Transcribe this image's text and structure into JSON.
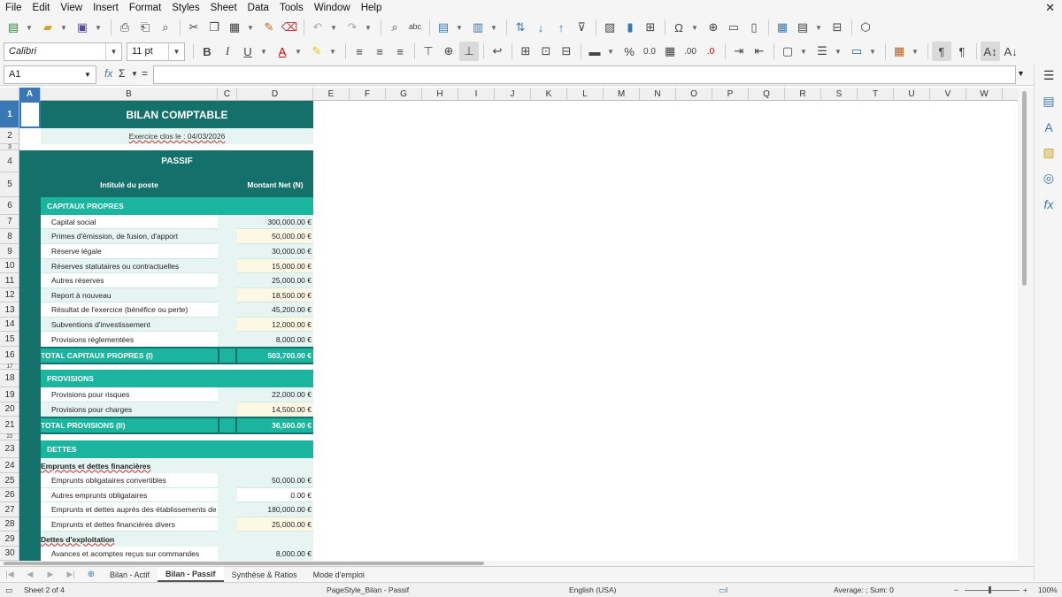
{
  "menu": [
    "File",
    "Edit",
    "View",
    "Insert",
    "Format",
    "Styles",
    "Sheet",
    "Data",
    "Tools",
    "Window",
    "Help"
  ],
  "toolbar": {
    "font_name": "Calibri",
    "font_size": "11 pt"
  },
  "formula_bar": {
    "cell_ref": "A1",
    "value": ""
  },
  "columns": [
    "A",
    "B",
    "C",
    "D",
    "E",
    "F",
    "G",
    "H",
    "I",
    "J",
    "K",
    "L",
    "M",
    "N",
    "O",
    "P",
    "Q",
    "R",
    "S",
    "T",
    "U",
    "V",
    "W"
  ],
  "rows": [
    "1",
    "2",
    "3",
    "4",
    "5",
    "6",
    "7",
    "8",
    "9",
    "10",
    "11",
    "12",
    "13",
    "14",
    "15",
    "16",
    "17",
    "18",
    "19",
    "20",
    "21",
    "22",
    "23",
    "24",
    "25",
    "26",
    "27",
    "28",
    "29",
    "30"
  ],
  "sheet": {
    "title": "BILAN COMPTABLE",
    "subtitle": "Exercice clos le : 04/03/2026",
    "section_header": "PASSIF",
    "col_label": "Intitulé du poste",
    "col_amount": "Montant Net (N)",
    "cap_header": "CAPITAUX PROPRES",
    "cap_items": [
      {
        "label": "Capital social",
        "amount": "300,000.00 €"
      },
      {
        "label": "Primes d'émission, de fusion, d'apport",
        "amount": "50,000.00 €"
      },
      {
        "label": "Réserve légale",
        "amount": "30,000.00 €"
      },
      {
        "label": "Réserves statutaires ou contractuelles",
        "amount": "15,000.00 €"
      },
      {
        "label": "Autres réserves",
        "amount": "25,000.00 €"
      },
      {
        "label": "Report à nouveau",
        "amount": "18,500.00 €"
      },
      {
        "label": "Résultat de l'exercice (bénéfice ou perte)",
        "amount": "45,200.00 €"
      },
      {
        "label": "Subventions d'investissement",
        "amount": "12,000.00 €"
      },
      {
        "label": "Provisions réglementées",
        "amount": "8,000.00 €"
      }
    ],
    "cap_total_label": "TOTAL CAPITAUX PROPRES (I)",
    "cap_total": "503,700.00 €",
    "prov_header": "PROVISIONS",
    "prov_items": [
      {
        "label": "Provisions pour risques",
        "amount": "22,000.00 €"
      },
      {
        "label": "Provisions pour charges",
        "amount": "14,500.00 €"
      }
    ],
    "prov_total_label": "TOTAL PROVISIONS (II)",
    "prov_total": "36,500.00 €",
    "debt_header": "DETTES",
    "debt_sub1": "Emprunts et dettes financières",
    "debt_items": [
      {
        "label": "Emprunts obligataires convertibles",
        "amount": "50,000.00 €"
      },
      {
        "label": "Autres emprunts obligataires",
        "amount": "0.00 €"
      },
      {
        "label": "Emprunts et dettes auprès des établissements de crédit",
        "amount": "180,000.00 €"
      },
      {
        "label": "Emprunts et dettes financières divers",
        "amount": "25,000.00 €"
      }
    ],
    "debt_sub2": "Dettes d'exploitation",
    "debt_items2": [
      {
        "label": "Avances et acomptes reçus sur commandes",
        "amount": "8,000.00 €"
      }
    ]
  },
  "tabs": [
    "Bilan - Actif",
    "Bilan - Passif",
    "Synthèse & Ratios",
    "Mode d'emploi"
  ],
  "status": {
    "sheet": "Sheet 2 of 4",
    "pagestyle": "PageStyle_Bilan - Passif",
    "language": "English (USA)",
    "sum": "Average: ; Sum: 0",
    "zoom": "100%"
  },
  "colors": {
    "teal_dark": "#13706a",
    "teal": "#1bb49f",
    "teal_light": "#e6f4f2",
    "cream": "#fdf8e4"
  }
}
